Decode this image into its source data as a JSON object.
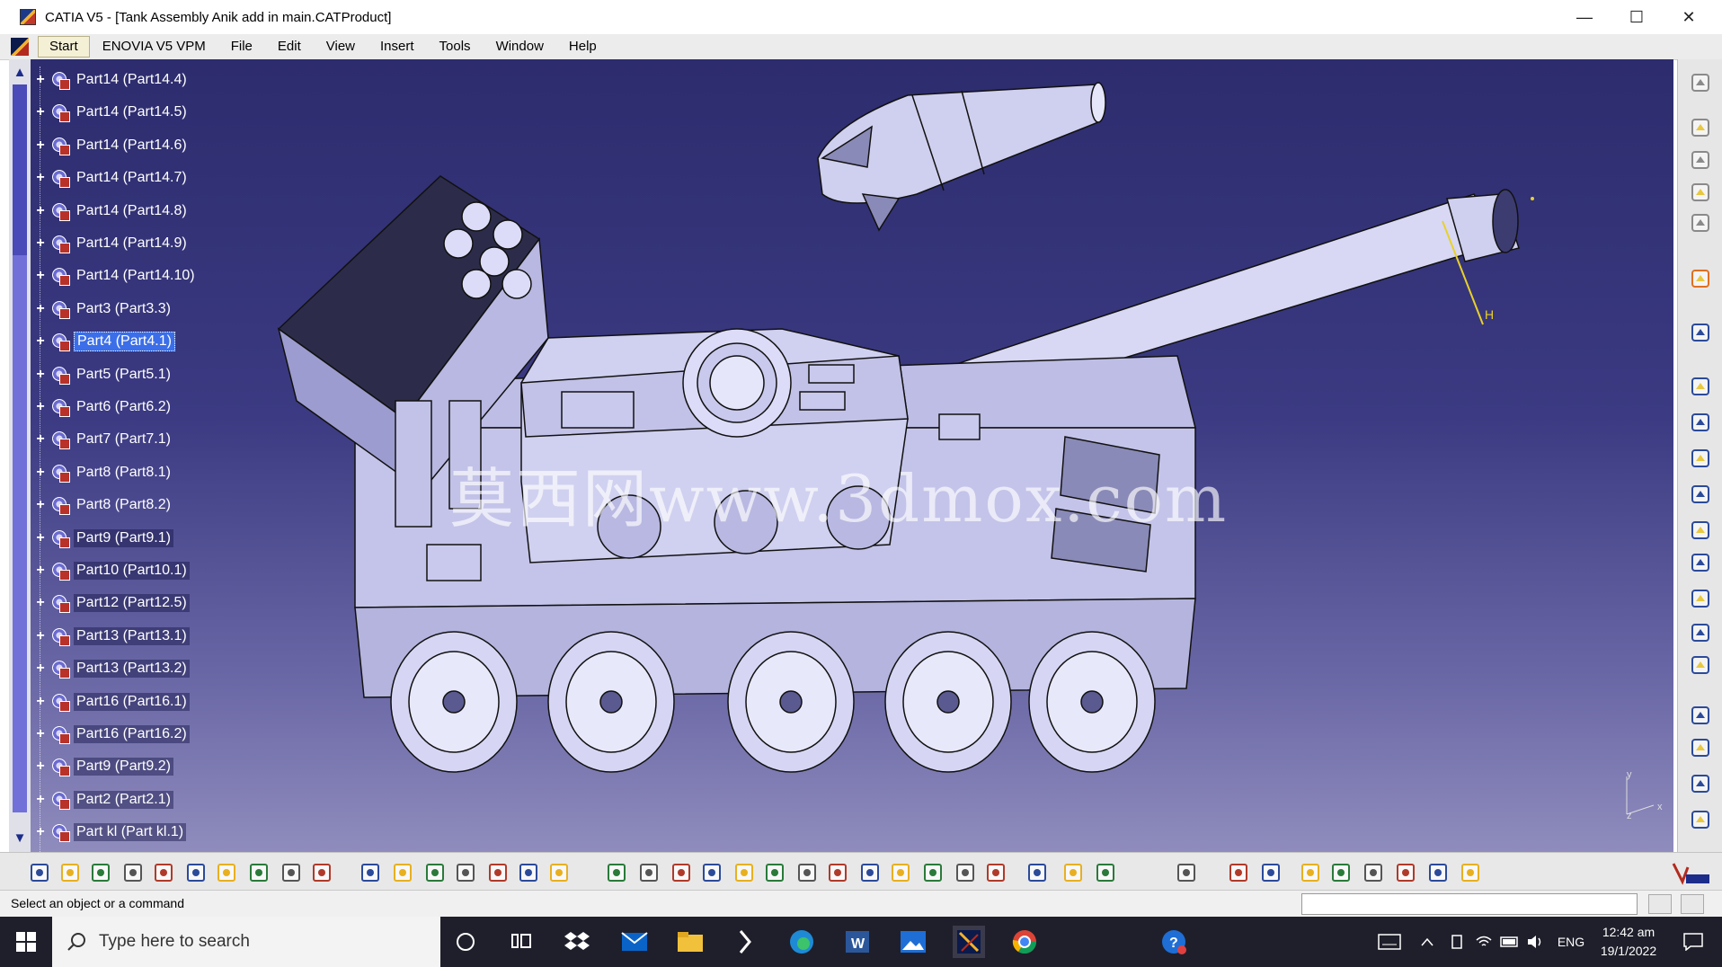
{
  "window": {
    "title": "CATIA V5 - [Tank Assembly Anik add in main.CATProduct]",
    "minimize": "—",
    "maximize": "☐",
    "close": "✕"
  },
  "menu": {
    "items": [
      "Start",
      "ENOVIA V5 VPM",
      "File",
      "Edit",
      "View",
      "Insert",
      "Tools",
      "Window",
      "Help"
    ]
  },
  "tree": {
    "items": [
      {
        "label": "Part14 (Part14.4)",
        "selected": false
      },
      {
        "label": "Part14 (Part14.5)",
        "selected": false
      },
      {
        "label": "Part14 (Part14.6)",
        "selected": false
      },
      {
        "label": "Part14 (Part14.7)",
        "selected": false
      },
      {
        "label": "Part14 (Part14.8)",
        "selected": false
      },
      {
        "label": "Part14 (Part14.9)",
        "selected": false
      },
      {
        "label": "Part14 (Part14.10)",
        "selected": false
      },
      {
        "label": "Part3 (Part3.3)",
        "selected": false
      },
      {
        "label": "Part4 (Part4.1)",
        "selected": true
      },
      {
        "label": "Part5 (Part5.1)",
        "selected": false
      },
      {
        "label": "Part6 (Part6.2)",
        "selected": false
      },
      {
        "label": "Part7 (Part7.1)",
        "selected": false
      },
      {
        "label": "Part8 (Part8.1)",
        "selected": false
      },
      {
        "label": "Part8 (Part8.2)",
        "selected": false
      },
      {
        "label": "Part9 (Part9.1)",
        "selected": false
      },
      {
        "label": "Part10 (Part10.1)",
        "selected": false
      },
      {
        "label": "Part12 (Part12.5)",
        "selected": false
      },
      {
        "label": "Part13 (Part13.1)",
        "selected": false
      },
      {
        "label": "Part13 (Part13.2)",
        "selected": false
      },
      {
        "label": "Part16 (Part16.1)",
        "selected": false
      },
      {
        "label": "Part16 (Part16.2)",
        "selected": false
      },
      {
        "label": "Part9 (Part9.2)",
        "selected": false
      },
      {
        "label": "Part2 (Part2.1)",
        "selected": false
      },
      {
        "label": "Part kl (Part kl.1)",
        "selected": false
      }
    ]
  },
  "viewport": {
    "watermark": "莫西网www.3dmox.com",
    "compass_x": "x",
    "compass_y": "y",
    "compass_z": "z",
    "dimension_label": "H"
  },
  "status": {
    "message": "Select an object or a command"
  },
  "taskbar": {
    "search_placeholder": "Type here to search",
    "language": "ENG",
    "time": "12:42 am",
    "date": "19/1/2022"
  },
  "colors": {
    "viewport_top": "#2d2c6e",
    "viewport_bottom": "#8f8cbd",
    "selection": "#3b6ee8",
    "model_body": "#c9c9ee"
  }
}
